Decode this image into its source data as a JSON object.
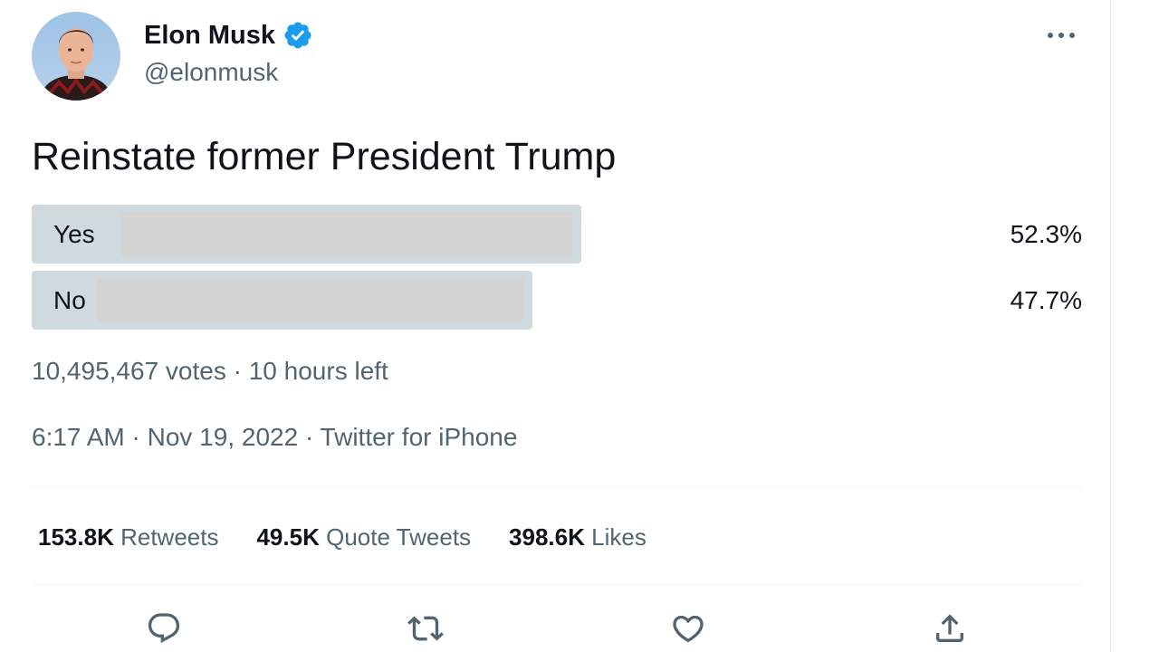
{
  "author": {
    "name": "Elon Musk",
    "handle": "@elonmusk",
    "verified": true,
    "verified_color": "#1d9bf0"
  },
  "menu": {
    "icon": "more-horizontal-icon",
    "label": "•••"
  },
  "tweet": {
    "text": "Reinstate former President Trump"
  },
  "poll": {
    "options": [
      {
        "label": "Yes",
        "percent_label": "52.3%",
        "percent": 52.3,
        "leading": true
      },
      {
        "label": "No",
        "percent_label": "47.7%",
        "percent": 47.7,
        "leading": false
      }
    ],
    "bar_color": "#cfd9de",
    "summary": "10,495,467 votes · 10 hours left"
  },
  "meta": {
    "timestamp": "6:17 AM · Nov 19, 2022 · Twitter for iPhone"
  },
  "stats": {
    "retweets": {
      "count": "153.8K",
      "label": "Retweets"
    },
    "quotes": {
      "count": "49.5K",
      "label": "Quote Tweets"
    },
    "likes": {
      "count": "398.6K",
      "label": "Likes"
    }
  },
  "actions": [
    {
      "name": "reply",
      "icon": "reply-icon"
    },
    {
      "name": "retweet",
      "icon": "retweet-icon"
    },
    {
      "name": "like",
      "icon": "heart-icon"
    },
    {
      "name": "share",
      "icon": "share-icon"
    }
  ],
  "colors": {
    "text_primary": "#0f1419",
    "text_secondary": "#536471",
    "icon": "#536471",
    "divider": "#eff3f4"
  }
}
